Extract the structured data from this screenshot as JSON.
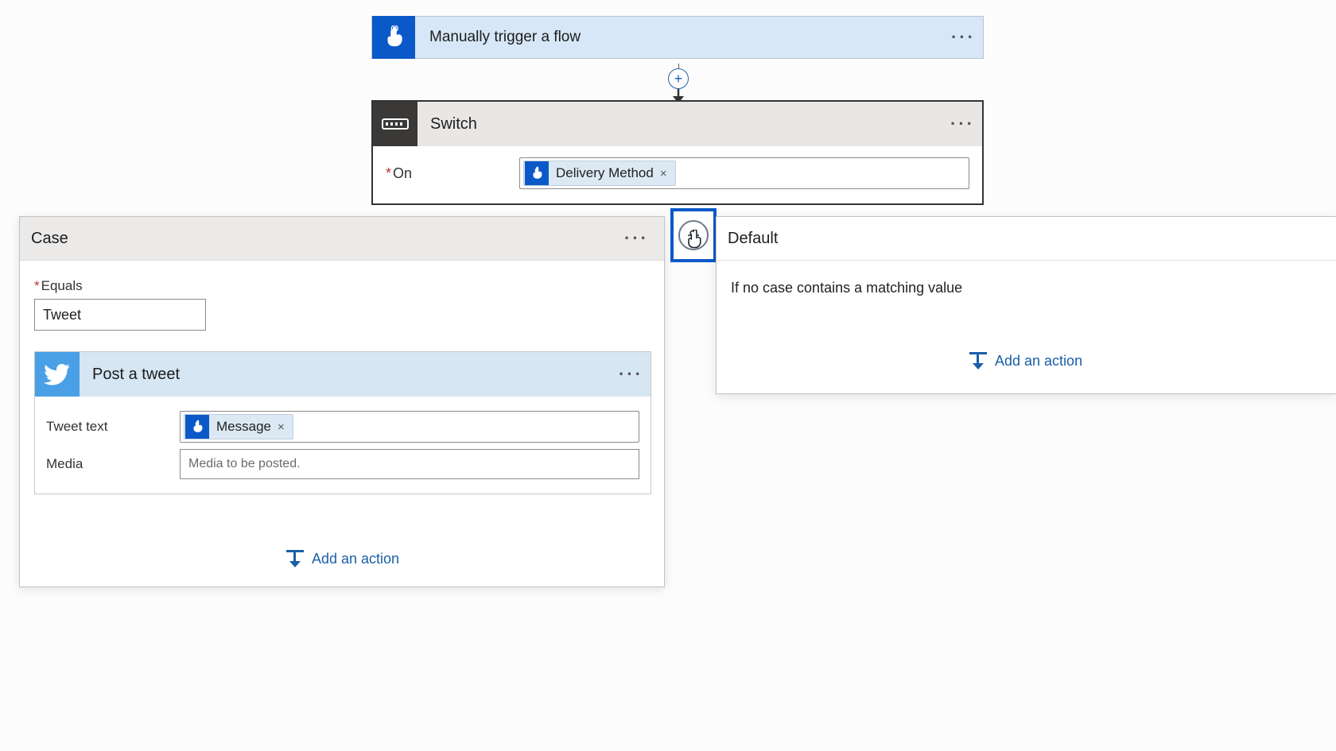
{
  "trigger": {
    "title": "Manually trigger a flow"
  },
  "switch": {
    "title": "Switch",
    "on_label": "On",
    "on_token": "Delivery Method"
  },
  "case": {
    "title": "Case",
    "equals_label": "Equals",
    "equals_value": "Tweet",
    "tweet": {
      "title": "Post a tweet",
      "text_label": "Tweet text",
      "text_token": "Message",
      "media_label": "Media",
      "media_placeholder": "Media to be posted."
    },
    "add_action": "Add an action"
  },
  "default": {
    "title": "Default",
    "description": "If no case contains a matching value",
    "add_action": "Add an action"
  }
}
